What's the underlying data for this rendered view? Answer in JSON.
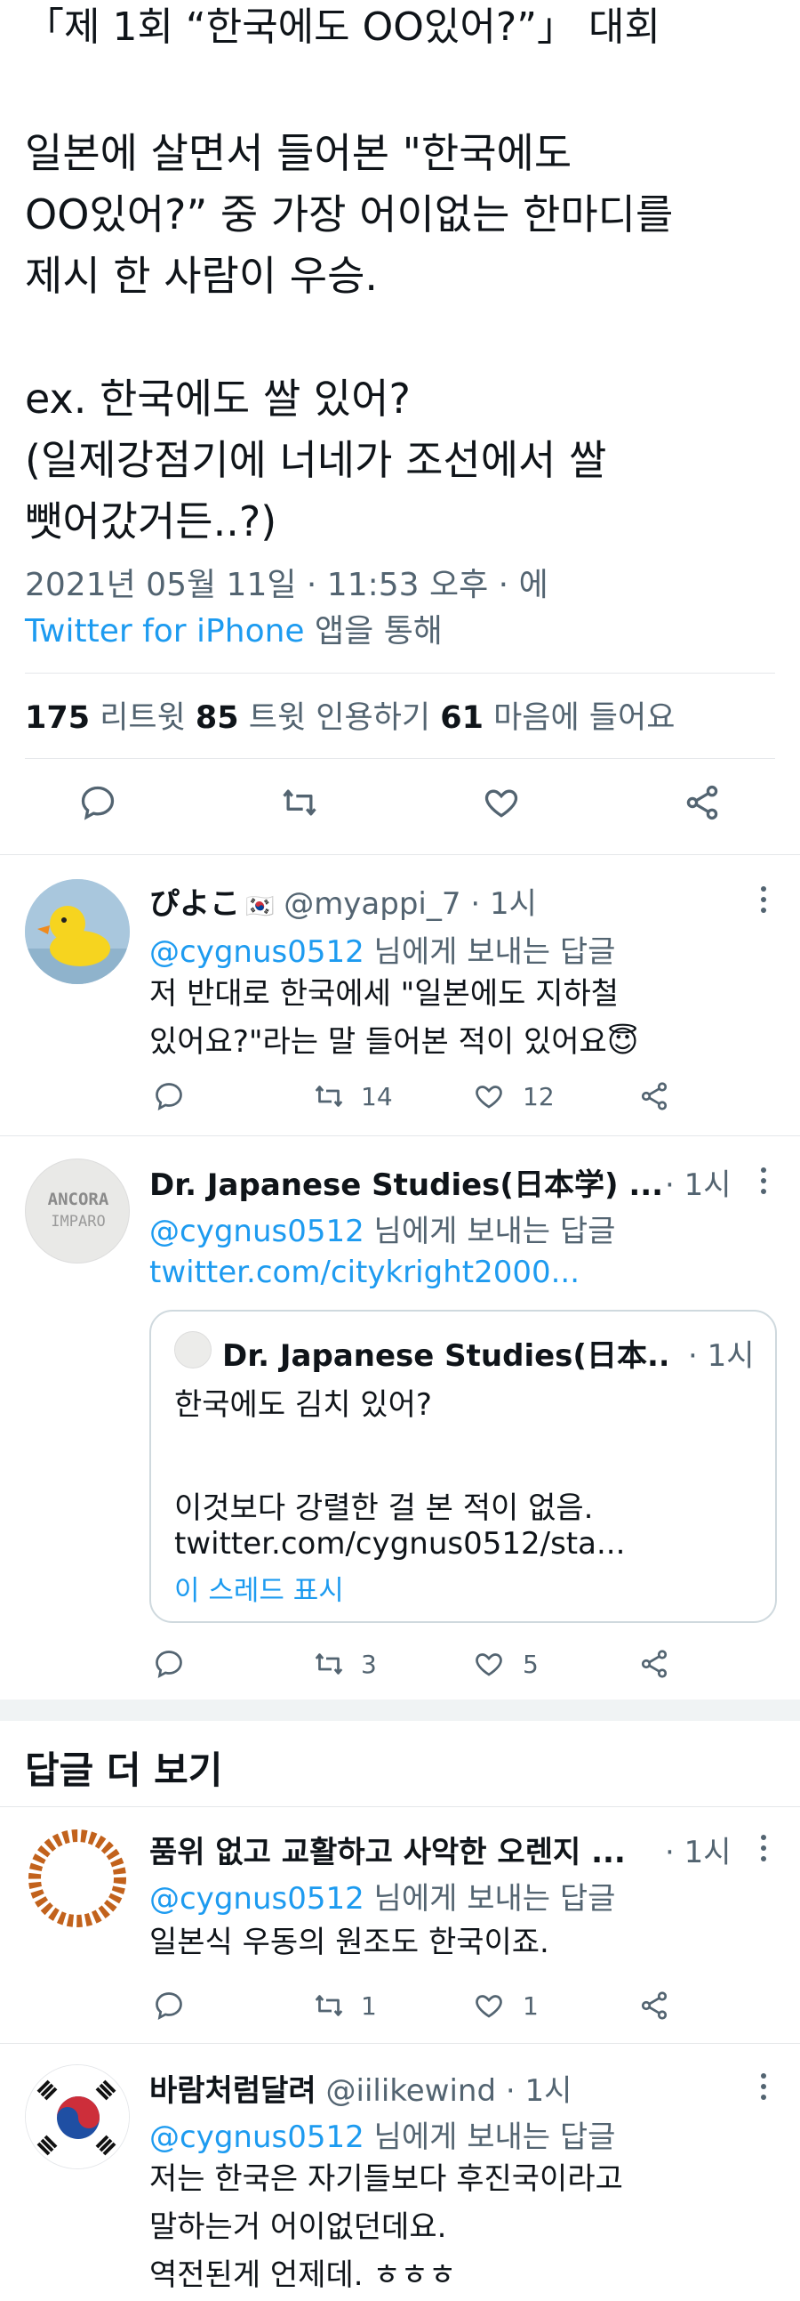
{
  "tweet": {
    "title_line": "「제 1회 “한국에도 OO있어?”」 대회",
    "body": "일본에 살면서 들어본 \"한국에도\nOO있어?” 중 가장 어이없는 한마디를\n제시 한 사람이 우승.\n\nex. 한국에도 쌀 있어?\n(일제강점기에 너네가 조선에서 쌀\n뺏어갔거든..?)",
    "timestamp": "2021년 05월 11일 · 11:53 오후 · 에",
    "source_app": "Twitter for iPhone",
    "source_suffix": " 앱을 통해",
    "retweets_count": "175",
    "retweets_label": " 리트윗  ",
    "quotes_count": "85",
    "quotes_label": " 트윗 인용하기  ",
    "likes_count": "61",
    "likes_label": " 마음에 들어요"
  },
  "replies": [
    {
      "name": "ぴよこ",
      "flag": "🇰🇷",
      "handle": "@myappi_7",
      "time": "· 1시",
      "to_mention": "@cygnus0512",
      "to_suffix": " 님에게 보내는 답글",
      "text": "저 반대로 한국에세 \"일본에도 지하철\n있어요?\"라는 말 들어본 적이 있어요😇",
      "retweets": "14",
      "likes": "12"
    },
    {
      "name": "Dr. Japanese Studies(日本学) ...",
      "time": "· 1시",
      "avatar_text_1": "ANCORA",
      "avatar_text_2": "IMPARO",
      "to_mention": "@cygnus0512",
      "to_suffix": " 님에게 보내는 답글",
      "link": "twitter.com/citykright2000...",
      "quoted": {
        "name": "Dr. Japanese Studies(日本...",
        "time": "· 1시",
        "text": "한국에도 김치 있어?\n\n이것보다 강렬한 걸 본 적이 없음.",
        "link": "twitter.com/cygnus0512/sta...",
        "thread": "이 스레드 표시"
      },
      "retweets": "3",
      "likes": "5"
    }
  ],
  "more_replies_title": "답글 더 보기",
  "more_replies": [
    {
      "name": "품위 없고 교활하고 사악한 오렌지 ...",
      "time": "· 1시",
      "to_mention": "@cygnus0512",
      "to_suffix": " 님에게 보내는 답글",
      "text": "일본식 우동의 원조도 한국이죠.",
      "retweets": "1",
      "likes": "1"
    },
    {
      "name": "바람처럼달려",
      "handle": "@iilikewind",
      "time": "· 1시",
      "to_mention": "@cygnus0512",
      "to_suffix": " 님에게 보내는 답글",
      "text": "저는 한국은 자기들보다 후진국이라고\n말하는거 어이없던데요.\n역전된게 언제데. ㅎㅎㅎ"
    }
  ],
  "colors": {
    "accent": "#1d9bf0",
    "secondary_text": "#536471",
    "primary_text": "#0f1419",
    "divider": "#e5e7ea"
  },
  "icons": {
    "reply": "reply-icon",
    "retweet": "retweet-icon",
    "like": "heart-icon",
    "share": "share-icon",
    "more": "more-options-icon"
  }
}
